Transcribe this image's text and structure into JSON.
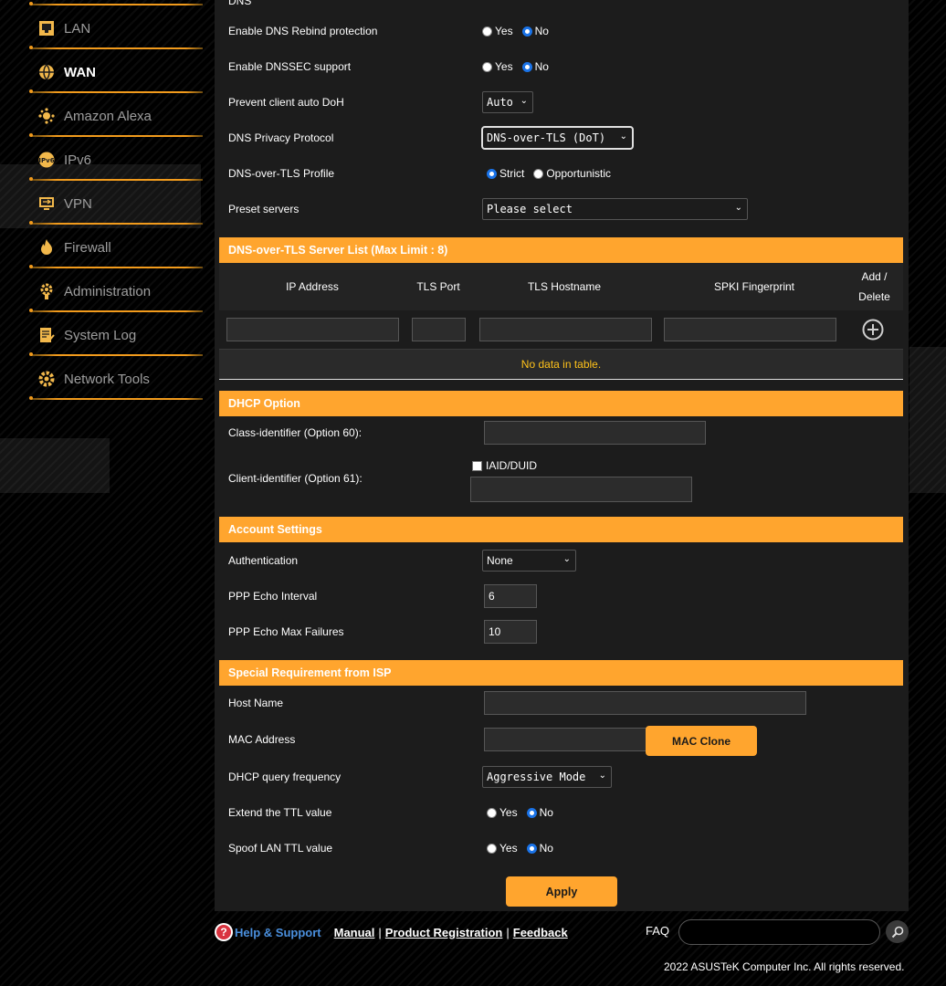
{
  "sidebar": {
    "items": [
      {
        "label": "LAN",
        "icon": "lan-icon"
      },
      {
        "label": "WAN",
        "icon": "globe-icon"
      },
      {
        "label": "Amazon Alexa",
        "icon": "alexa-icon"
      },
      {
        "label": "IPv6",
        "icon": "ipv6-icon"
      },
      {
        "label": "VPN",
        "icon": "vpn-icon"
      },
      {
        "label": "Firewall",
        "icon": "fire-icon"
      },
      {
        "label": "Administration",
        "icon": "admin-gear-icon"
      },
      {
        "label": "System Log",
        "icon": "system-log-icon"
      },
      {
        "label": "Network Tools",
        "icon": "network-tools-icon"
      }
    ],
    "active": "WAN"
  },
  "dns": {
    "section_label": "DNS",
    "rebind_label": "Enable DNS Rebind protection",
    "dnssec_label": "Enable DNSSEC support",
    "doh_label": "Prevent client auto DoH",
    "doh_value": "Auto",
    "privacy_label": "DNS Privacy Protocol",
    "privacy_value": "DNS-over-TLS (DoT)",
    "profile_label": "DNS-over-TLS Profile",
    "profile_strict": "Strict",
    "profile_opportunistic": "Opportunistic",
    "preset_label": "Preset servers",
    "preset_placeholder": "Please select",
    "yes": "Yes",
    "no": "No"
  },
  "tls_list": {
    "title": "DNS-over-TLS Server List (Max Limit : 8)",
    "col_ip": "IP Address",
    "col_port": "TLS Port",
    "col_host": "TLS Hostname",
    "col_spki": "SPKI Fingerprint",
    "col_add1": "Add /",
    "col_add2": "Delete",
    "empty": "No data in table."
  },
  "dhcp": {
    "title": "DHCP Option",
    "class_label": "Class-identifier (Option 60):",
    "client_label": "Client-identifier (Option 61):",
    "iaid_label": "IAID/DUID"
  },
  "account": {
    "title": "Account Settings",
    "auth_label": "Authentication",
    "auth_value": "None",
    "echo_label": "PPP Echo Interval",
    "echo_value": "6",
    "fail_label": "PPP Echo Max Failures",
    "fail_value": "10"
  },
  "isp": {
    "title": "Special Requirement from ISP",
    "host_label": "Host Name",
    "mac_label": "MAC Address",
    "mac_clone": "MAC Clone",
    "dhcpq_label": "DHCP query frequency",
    "dhcpq_value": "Aggressive Mode",
    "ttl_label": "Extend the TTL value",
    "spoof_label": "Spoof LAN TTL value"
  },
  "apply": "Apply",
  "footer": {
    "help": "Help & Support",
    "manual": "Manual",
    "registration": "Product Registration",
    "feedback": "Feedback",
    "faq": "FAQ",
    "copyright": "2022 ASUSTeK Computer Inc. All rights reserved."
  },
  "colors": {
    "accent": "#ffa52e",
    "radio_on": "#1a73e8",
    "panel": "#1c1c1c"
  }
}
